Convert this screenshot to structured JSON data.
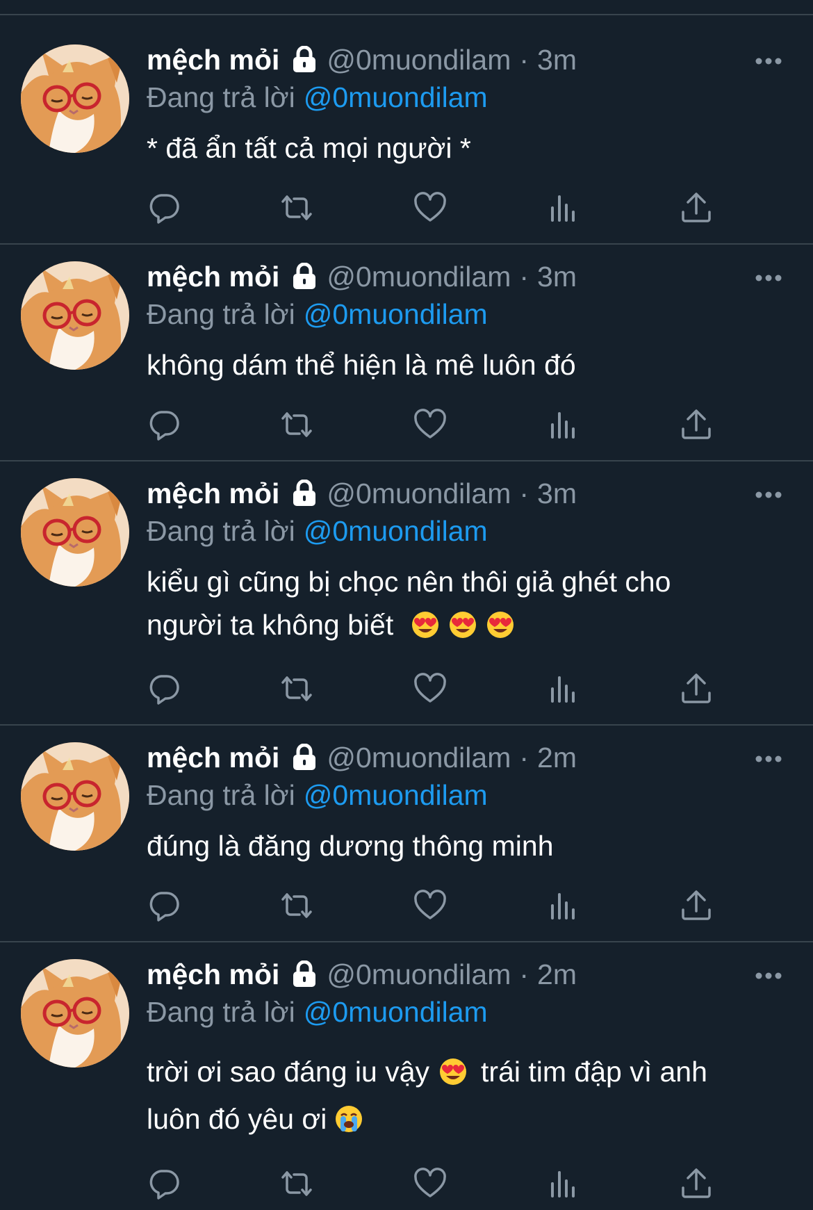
{
  "colors": {
    "background": "#15202b",
    "divider": "#38444d",
    "secondary_text": "#8b98a5",
    "link": "#1d9bf0",
    "primary_text": "#ffffff"
  },
  "tweets": [
    {
      "display_name": "mệch mỏi",
      "handle": "@0muondilam",
      "separator": "·",
      "time": "3m",
      "reply_prefix": "Đang trả lời",
      "reply_to": "@0muondilam",
      "text_lines": [
        "* đã ẩn tất cả mọi người *"
      ]
    },
    {
      "display_name": "mệch mỏi",
      "handle": "@0muondilam",
      "separator": "·",
      "time": "3m",
      "reply_prefix": "Đang trả lời",
      "reply_to": "@0muondilam",
      "text_lines": [
        "không dám thể hiện là mê luôn đó"
      ]
    },
    {
      "display_name": "mệch mỏi",
      "handle": "@0muondilam",
      "separator": "·",
      "time": "3m",
      "reply_prefix": "Đang trả lời",
      "reply_to": "@0muondilam",
      "text_lines": [
        "kiểu gì cũng bị chọc nên thôi giả ghét cho",
        "người ta không biết"
      ],
      "emojis": [
        "heart-eyes",
        "heart-eyes",
        "heart-eyes"
      ]
    },
    {
      "display_name": "mệch mỏi",
      "handle": "@0muondilam",
      "separator": "·",
      "time": "2m",
      "reply_prefix": "Đang trả lời",
      "reply_to": "@0muondilam",
      "text_lines": [
        "đúng là đăng dương thông minh"
      ]
    },
    {
      "display_name": "mệch mỏi",
      "handle": "@0muondilam",
      "separator": "·",
      "time": "2m",
      "reply_prefix": "Đang trả lời",
      "reply_to": "@0muondilam",
      "text_segments": [
        "trời ơi sao đáng iu vậy",
        "trái tim đập vì anh",
        "luôn đó yêu ơi"
      ],
      "emojis": [
        "heart-eyes",
        "loudly-crying"
      ]
    }
  ],
  "action_icons": [
    "reply-icon",
    "retweet-icon",
    "like-icon",
    "views-icon",
    "share-icon"
  ]
}
